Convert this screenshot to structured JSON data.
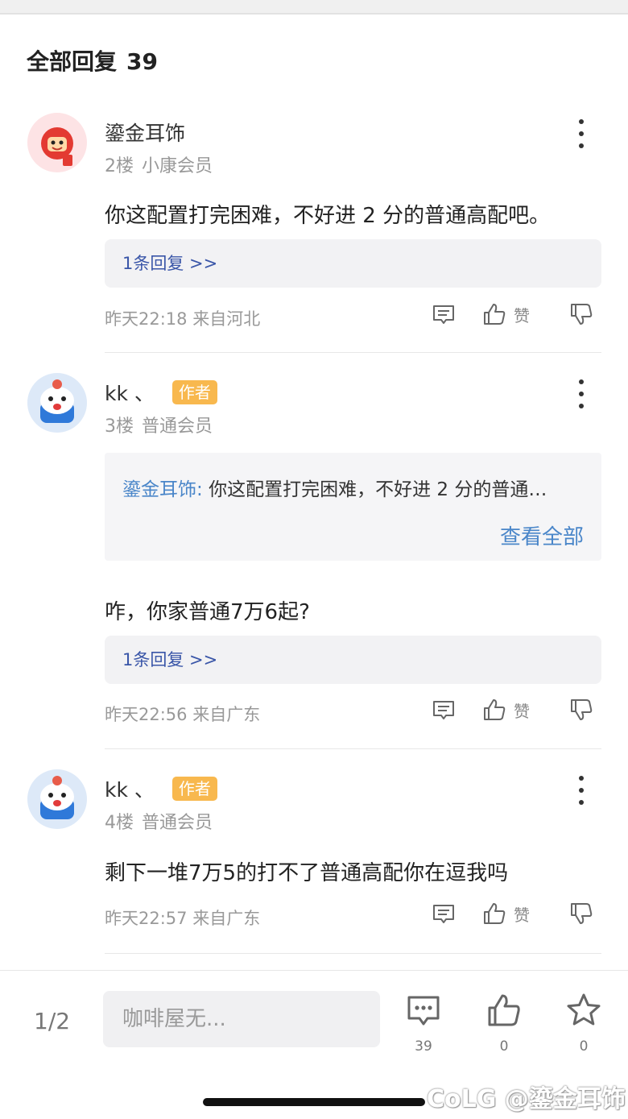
{
  "section": {
    "title": "全部回复",
    "count": "39"
  },
  "comments": [
    {
      "username": "鎏金耳饰",
      "floor": "2楼",
      "level": "小康会员",
      "text": "你这配置打完困难，不好进 2 分的普通高配吧。",
      "replies_link": "1条回复 >>",
      "time_location": "昨天22:18 来自河北",
      "like_label": "赞"
    },
    {
      "username": "kk 、",
      "badge": "作者",
      "floor": "3楼",
      "level": "普通会员",
      "quote": {
        "name": "鎏金耳饰:",
        "text": "你这配置打完困难，不好进 2 分的普通…",
        "view_all": "查看全部"
      },
      "text": "咋，你家普通7万6起?",
      "replies_link": "1条回复 >>",
      "time_location": "昨天22:56 来自广东",
      "like_label": "赞"
    },
    {
      "username": "kk 、",
      "badge": "作者",
      "floor": "4楼",
      "level": "普通会员",
      "text": "剩下一堆7万5的打不了普通高配你在逗我吗",
      "time_location": "昨天22:57 来自广东",
      "like_label": "赞"
    }
  ],
  "bottom_bar": {
    "page_indicator": "1/2",
    "input_placeholder": "咖啡屋无...",
    "comment_count": "39",
    "like_count": "0",
    "favorite_count": "0"
  },
  "watermark": "CoLG @鎏金耳饰",
  "colors": {
    "accent_blue": "#4a86c9",
    "reply_link": "#3a56a8",
    "author_badge": "#f8b84e"
  }
}
